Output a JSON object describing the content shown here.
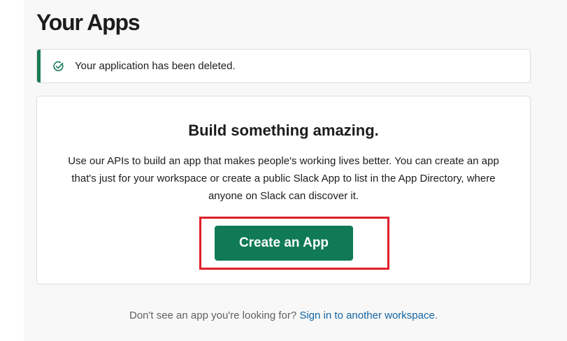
{
  "header": {
    "title": "Your Apps"
  },
  "alert": {
    "icon": "check-circle-icon",
    "message": "Your application has been deleted.",
    "accent_color": "#1a7a56"
  },
  "card": {
    "title": "Build something amazing.",
    "description": "Use our APIs to build an app that makes people's working lives better. You can create an app that's just for your workspace or create a public Slack App to list in the App Directory, where anyone on Slack can discover it.",
    "button_label": "Create an App",
    "button_color": "#0f7a55",
    "highlight_color": "#e01e2a"
  },
  "footer": {
    "prompt": "Don't see an app you're looking for?",
    "link_label": "Sign in to another workspace",
    "link_suffix": ".",
    "link_color": "#1264a3"
  }
}
